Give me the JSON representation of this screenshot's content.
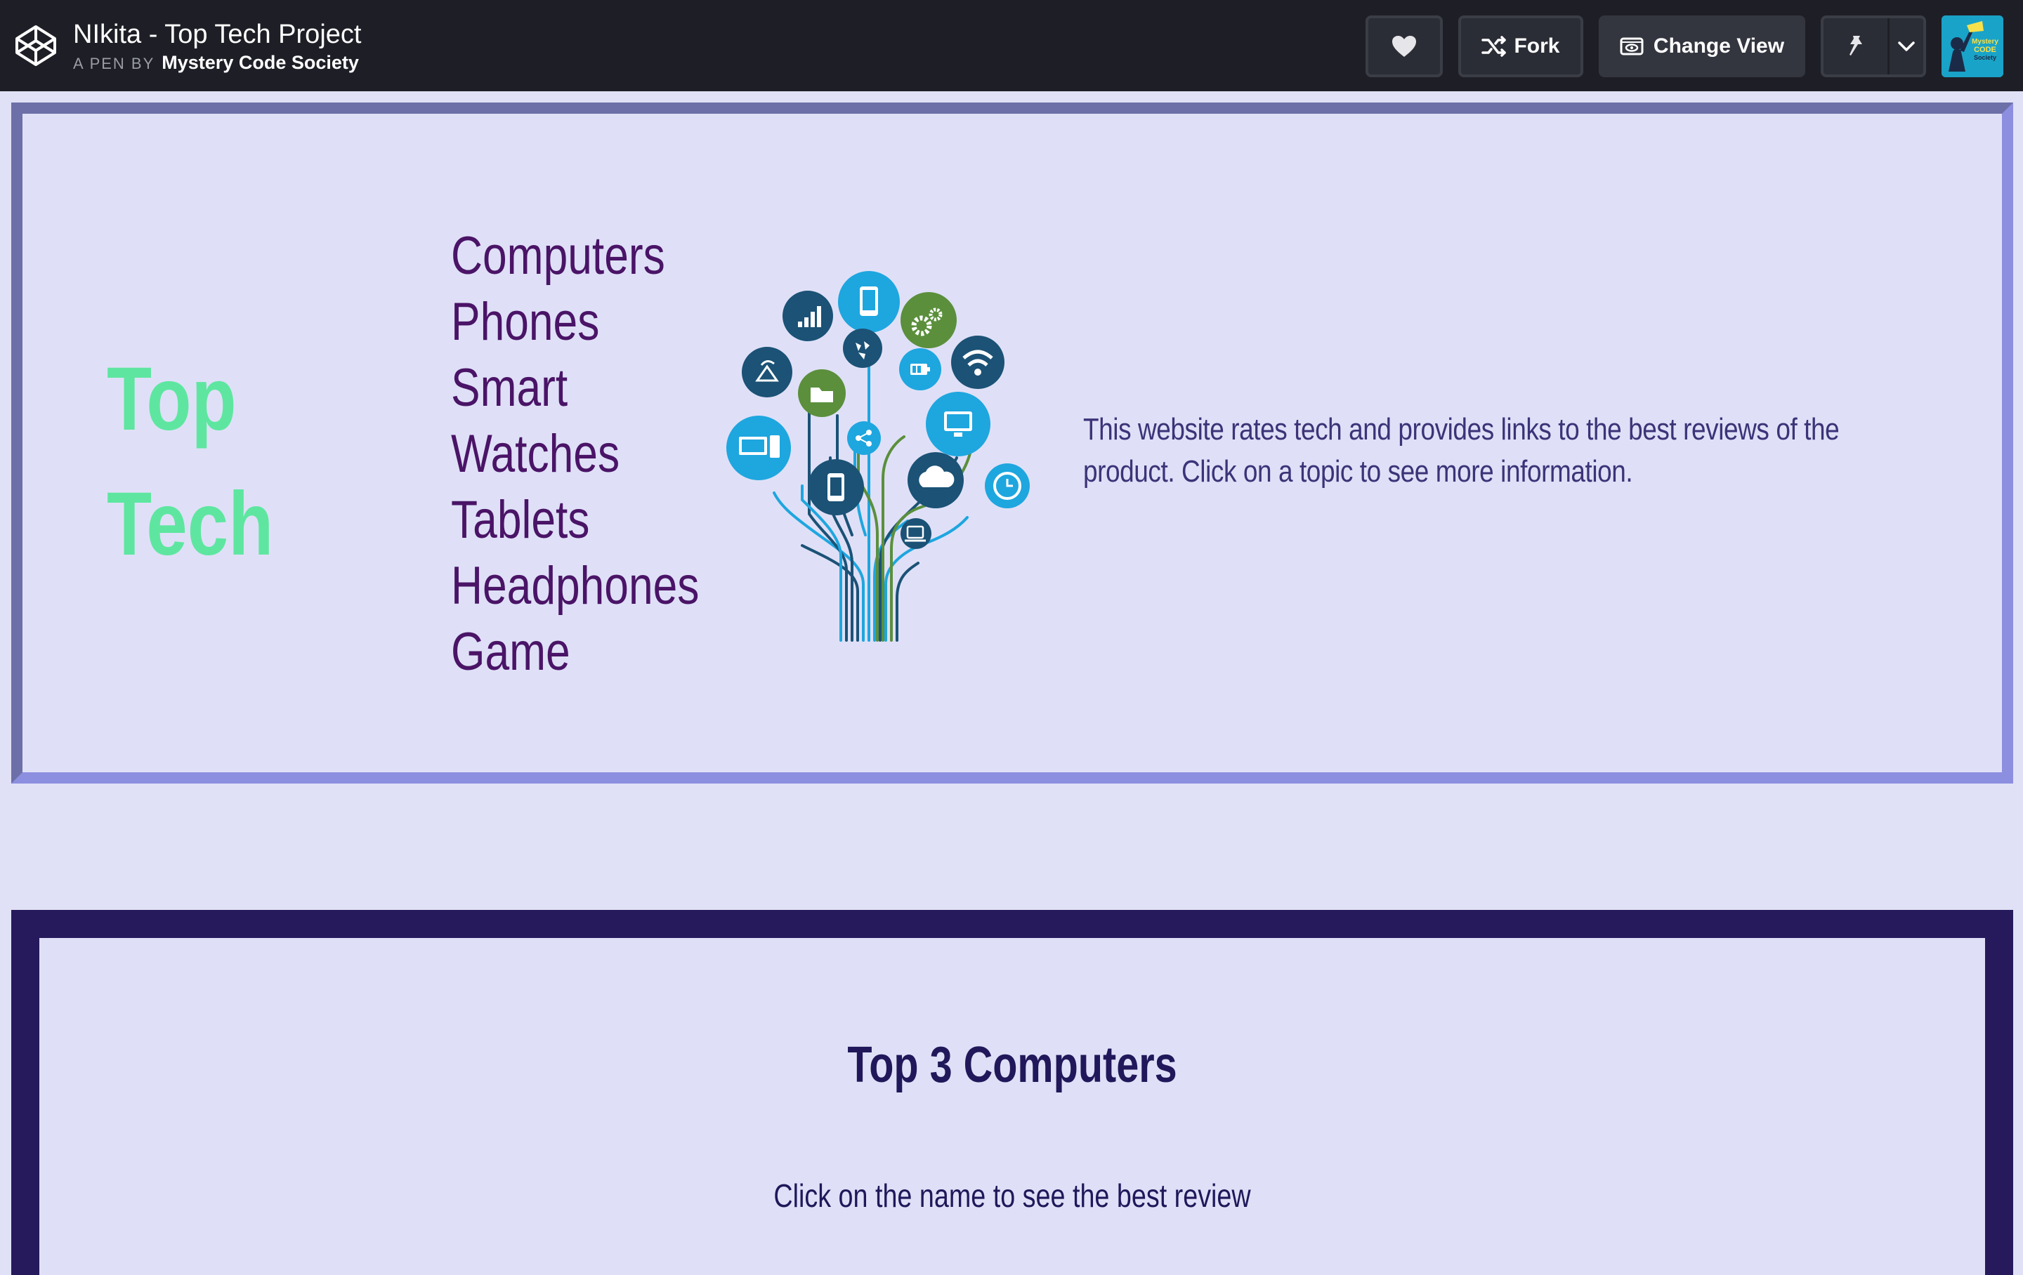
{
  "header": {
    "pen_title": "NIkita - Top Tech Project",
    "pen_by_label": "A PEN BY",
    "author": "Mystery Code Society",
    "buttons": {
      "heart_icon": "heart-icon",
      "fork_label": "Fork",
      "change_view_label": "Change View",
      "pin_icon": "pin-icon",
      "dropdown_icon": "chevron-down-icon"
    },
    "avatar_text": [
      "Mystery",
      "CODE",
      "Society"
    ]
  },
  "hero": {
    "brand": [
      "Top",
      "Tech"
    ],
    "nav_items": [
      "Computers",
      "Phones",
      "Smart",
      "Watches",
      "Tablets",
      "Headphones",
      "Game"
    ],
    "intro": "This website rates tech and provides links to the best reviews of the product. Click on a topic to see more information.",
    "colors": {
      "brand": "#5ee6a0",
      "nav": "#4a1467",
      "intro": "#3c3378",
      "background": "#dfe0f7"
    }
  },
  "computers_section": {
    "title": "Top 3 Computers",
    "subtitle": "Click on the name to see the best review",
    "colors": {
      "frame": "#261a5c",
      "text": "#20185a"
    }
  }
}
